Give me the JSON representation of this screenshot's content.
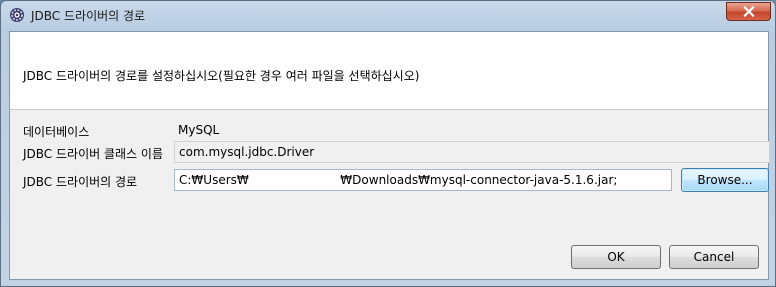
{
  "window": {
    "title": "JDBC 드라이버의 경로",
    "icons": {
      "app": "eclipse-gear-icon",
      "close": "close-icon"
    },
    "close_color": "#c3452b"
  },
  "message": "JDBC 드라이버의 경로를 설정하십시오(필요한 경우 여러 파일을 선택하십시오)",
  "form": {
    "database_label": "데이터베이스",
    "database_value": "MySQL",
    "driver_class_label": "JDBC 드라이버 클래스 이름",
    "driver_class_value": "com.mysql.jdbc.Driver",
    "driver_path_label": "JDBC 드라이버의 경로",
    "driver_path_value": "C:₩Users₩                        ₩Downloads₩mysql-connector-java-5.1.6.jar;"
  },
  "buttons": {
    "browse": "Browse...",
    "ok": "OK",
    "cancel": "Cancel"
  }
}
